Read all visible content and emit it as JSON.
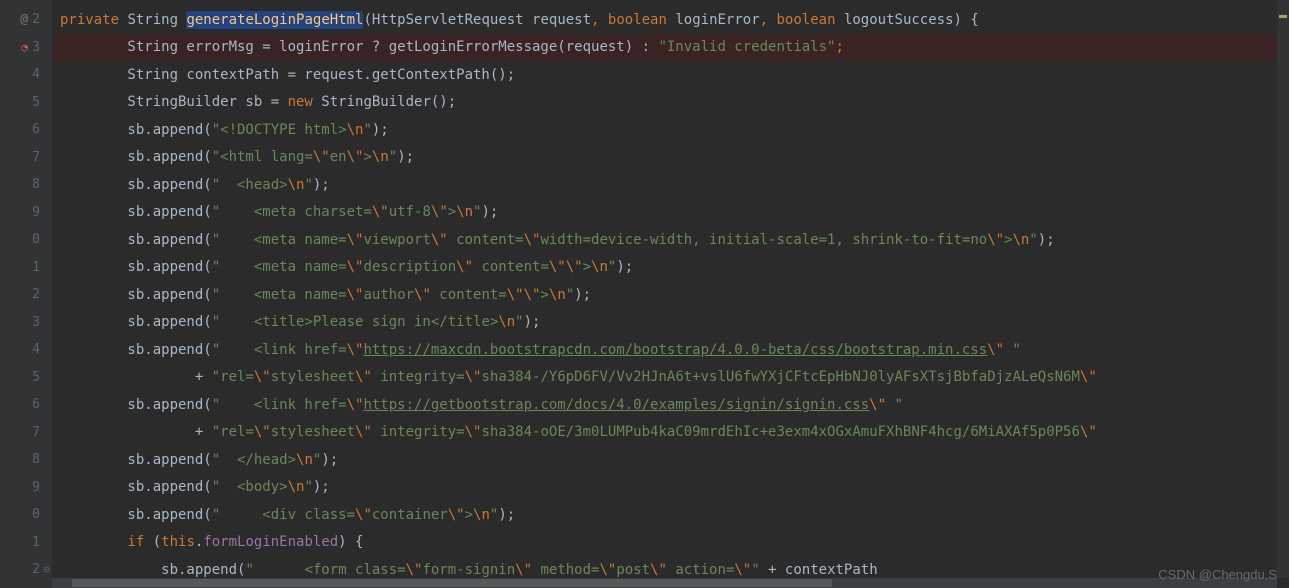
{
  "gutter": {
    "lines": [
      "2",
      "3",
      "4",
      "5",
      "6",
      "7",
      "8",
      "9",
      "0",
      "1",
      "2",
      "3",
      "4",
      "5",
      "6",
      "7",
      "8",
      "9",
      "0",
      "1",
      "2"
    ]
  },
  "code": {
    "l02": {
      "kw1": "private",
      "type1": " String ",
      "method": "generateLoginPageHtml",
      "params": "(HttpServletRequest request",
      "comma1": ", ",
      "kw2": "boolean",
      "param2": " loginError",
      "comma2": ", ",
      "kw3": "boolean",
      "param3": " logoutSuccess) {"
    },
    "l03": {
      "pre": "        String errorMsg = loginError ? getLoginErrorMessage(request) : ",
      "str": "\"Invalid credentials\"",
      "post": ";"
    },
    "l04": {
      "text": "        String contextPath = request.getContextPath();"
    },
    "l05": {
      "pre": "        StringBuilder sb = ",
      "kw": "new",
      "post": " StringBuilder();"
    },
    "l06": {
      "pre": "        sb.append(",
      "str1": "\"<!DOCTYPE html>",
      "esc": "\\n",
      "str2": "\"",
      "post": ");"
    },
    "l07": {
      "pre": "        sb.append(",
      "str1": "\"<html lang=",
      "esc1": "\\\"",
      "str2": "en",
      "esc2": "\\\"",
      "str3": ">",
      "esc3": "\\n",
      "str4": "\"",
      "post": ");"
    },
    "l08": {
      "pre": "        sb.append(",
      "str1": "\"  <head>",
      "esc": "\\n",
      "str2": "\"",
      "post": ");"
    },
    "l09": {
      "pre": "        sb.append(",
      "str1": "\"    <meta charset=",
      "esc1": "\\\"",
      "str2": "utf-8",
      "esc2": "\\\"",
      "str3": ">",
      "esc3": "\\n",
      "str4": "\"",
      "post": ");"
    },
    "l10": {
      "pre": "        sb.append(",
      "str1": "\"    <meta name=",
      "esc1": "\\\"",
      "str2": "viewport",
      "esc2": "\\\"",
      "str3": " content=",
      "esc3": "\\\"",
      "str4": "width=device-width, initial-scale=1, shrink-to-fit=no",
      "esc4": "\\\"",
      "str5": ">",
      "esc5": "\\n",
      "str6": "\"",
      "post": ");"
    },
    "l11": {
      "pre": "        sb.append(",
      "str1": "\"    <meta name=",
      "esc1": "\\\"",
      "str2": "description",
      "esc2": "\\\"",
      "str3": " content=",
      "esc3": "\\\"",
      "esc4": "\\\"",
      "str5": ">",
      "esc5": "\\n",
      "str6": "\"",
      "post": ");"
    },
    "l12": {
      "pre": "        sb.append(",
      "str1": "\"    <meta name=",
      "esc1": "\\\"",
      "str2": "author",
      "esc2": "\\\"",
      "str3": " content=",
      "esc3": "\\\"",
      "esc4": "\\\"",
      "str5": ">",
      "esc5": "\\n",
      "str6": "\"",
      "post": ");"
    },
    "l13": {
      "pre": "        sb.append(",
      "str1": "\"    <title>Please sign in</title>",
      "esc": "\\n",
      "str2": "\"",
      "post": ");"
    },
    "l14": {
      "pre": "        sb.append(",
      "str1": "\"    <link href=",
      "esc1": "\\\"",
      "link": "https://maxcdn.bootstrapcdn.com/bootstrap/4.0.0-beta/css/bootstrap.min.css",
      "esc2": "\\\"",
      "str3": " \""
    },
    "l15": {
      "pre": "                + ",
      "str1": "\"rel=",
      "esc1": "\\\"",
      "str2": "stylesheet",
      "esc2": "\\\"",
      "str3": " integrity=",
      "esc3": "\\\"",
      "str4": "sha384-/Y6pD6FV/Vv2HJnA6t+vslU6fwYXjCFtcEpHbNJ0lyAFsXTsjBbfaDjzALeQsN6M",
      "esc4": "\\\""
    },
    "l16": {
      "pre": "        sb.append(",
      "str1": "\"    <link href=",
      "esc1": "\\\"",
      "link": "https://getbootstrap.com/docs/4.0/examples/signin/signin.css",
      "esc2": "\\\"",
      "str3": " \""
    },
    "l17": {
      "pre": "                + ",
      "str1": "\"rel=",
      "esc1": "\\\"",
      "str2": "stylesheet",
      "esc2": "\\\"",
      "str3": " integrity=",
      "esc3": "\\\"",
      "str4": "sha384-oOE/3m0LUMPub4kaC09mrdEhIc+e3exm4xOGxAmuFXhBNF4hcg/6MiAXAf5p0P56",
      "esc4": "\\\""
    },
    "l18": {
      "pre": "        sb.append(",
      "str1": "\"  </head>",
      "esc": "\\n",
      "str2": "\"",
      "post": ");"
    },
    "l19": {
      "pre": "        sb.append(",
      "str1": "\"  <body>",
      "esc": "\\n",
      "str2": "\"",
      "post": ");"
    },
    "l20": {
      "pre": "        sb.append(",
      "str1": "\"     <div class=",
      "esc1": "\\\"",
      "str2": "container",
      "esc2": "\\\"",
      "str3": ">",
      "esc3": "\\n",
      "str4": "\"",
      "post": ");"
    },
    "l21": {
      "pre": "        ",
      "kw1": "if",
      "pre2": " (",
      "kw2": "this",
      "dot": ".",
      "field": "formLoginEnabled",
      "post": ") {"
    },
    "l22": {
      "pre": "            sb.append(",
      "str1": "\"      <form class=",
      "esc1": "\\\"",
      "str2": "form-signin",
      "esc2": "\\\"",
      "str3": " method=",
      "esc3": "\\\"",
      "str4": "post",
      "esc4": "\\\"",
      "str5": " action=",
      "esc5": "\\\"",
      "str6": "\"",
      "plus": " + contextPath"
    }
  },
  "watermark": "CSDN @Chengdu.S"
}
